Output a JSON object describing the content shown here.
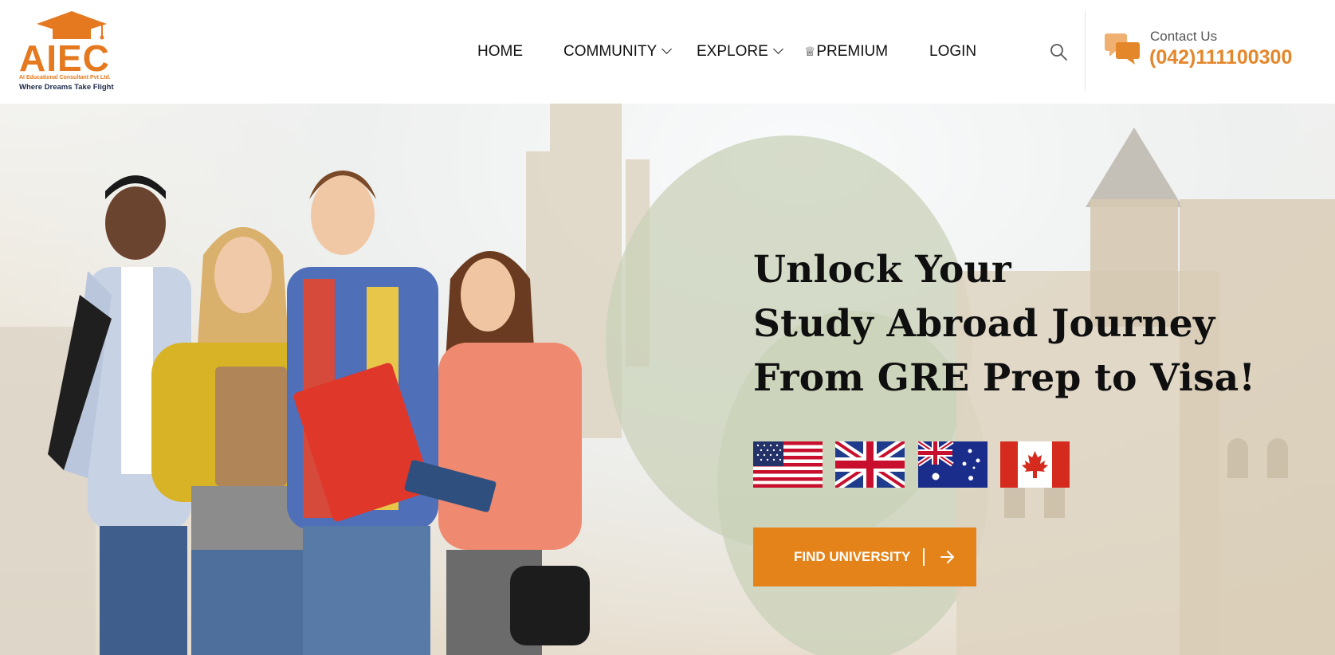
{
  "brand": {
    "name": "AIEC",
    "company": "AI Educational Consultant Pvt Ltd.",
    "tagline": "Where Dreams Take Flight",
    "accent_color": "#e4791f"
  },
  "nav": {
    "items": [
      {
        "label": "HOME",
        "has_dropdown": false
      },
      {
        "label": "COMMUNITY",
        "has_dropdown": true
      },
      {
        "label": "EXPLORE",
        "has_dropdown": true
      },
      {
        "label": "PREMIUM",
        "has_dropdown": false,
        "icon": "crown-icon"
      },
      {
        "label": "LOGIN",
        "has_dropdown": false
      }
    ],
    "search_icon": "search-icon"
  },
  "contact": {
    "label": "Contact Us",
    "phone": "(042)111100300",
    "icon": "chat-bubbles-icon",
    "phone_color": "#e4872a"
  },
  "hero": {
    "headline": [
      "Unlock Your",
      "Study Abroad Journey",
      "From GRE Prep to Visa!"
    ],
    "flags": [
      "us-flag",
      "uk-flag",
      "australia-flag",
      "canada-flag"
    ],
    "cta_label": "FIND UNIVERSITY",
    "cta_icon": "arrow-right-icon",
    "cta_color": "#e4831a"
  }
}
